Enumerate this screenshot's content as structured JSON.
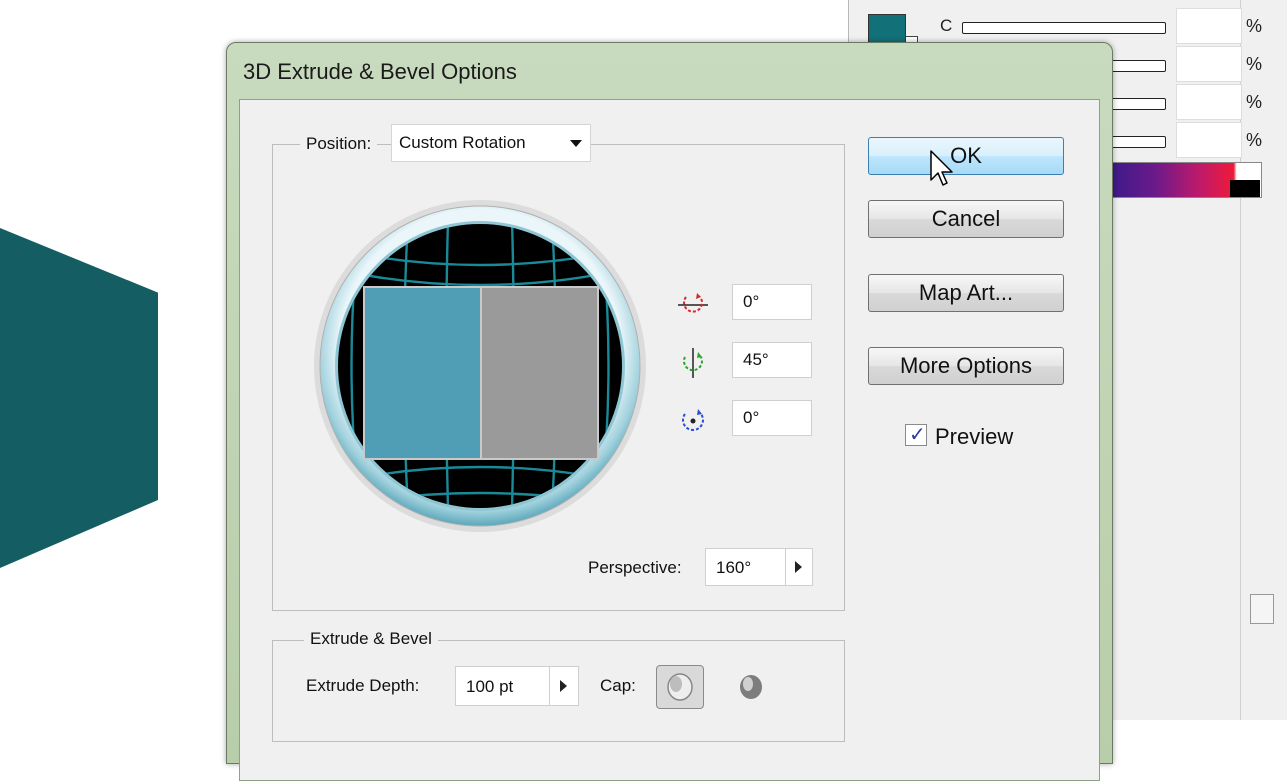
{
  "dialog": {
    "title": "3D Extrude & Bevel Options"
  },
  "position": {
    "label": "Position:",
    "selected": "Custom Rotation"
  },
  "rotation": {
    "x_value": "0°",
    "y_value": "45°",
    "z_value": "0°"
  },
  "perspective": {
    "label": "Perspective:",
    "value": "160°"
  },
  "buttons": {
    "ok": "OK",
    "cancel": "Cancel",
    "map_art": "Map Art...",
    "more_options": "More Options"
  },
  "preview": {
    "label": "Preview",
    "checked": true
  },
  "extrude": {
    "group_label": "Extrude & Bevel",
    "depth_label": "Extrude Depth:",
    "depth_value": "100 pt",
    "cap_label": "Cap:"
  },
  "color_panel": {
    "channel_label": "C",
    "percent_sign": "%",
    "swatch_color": "#127078"
  },
  "colors": {
    "artwork": "#145d63",
    "cube_front": "#4f9eb6",
    "cube_side": "#9a9a9a"
  }
}
